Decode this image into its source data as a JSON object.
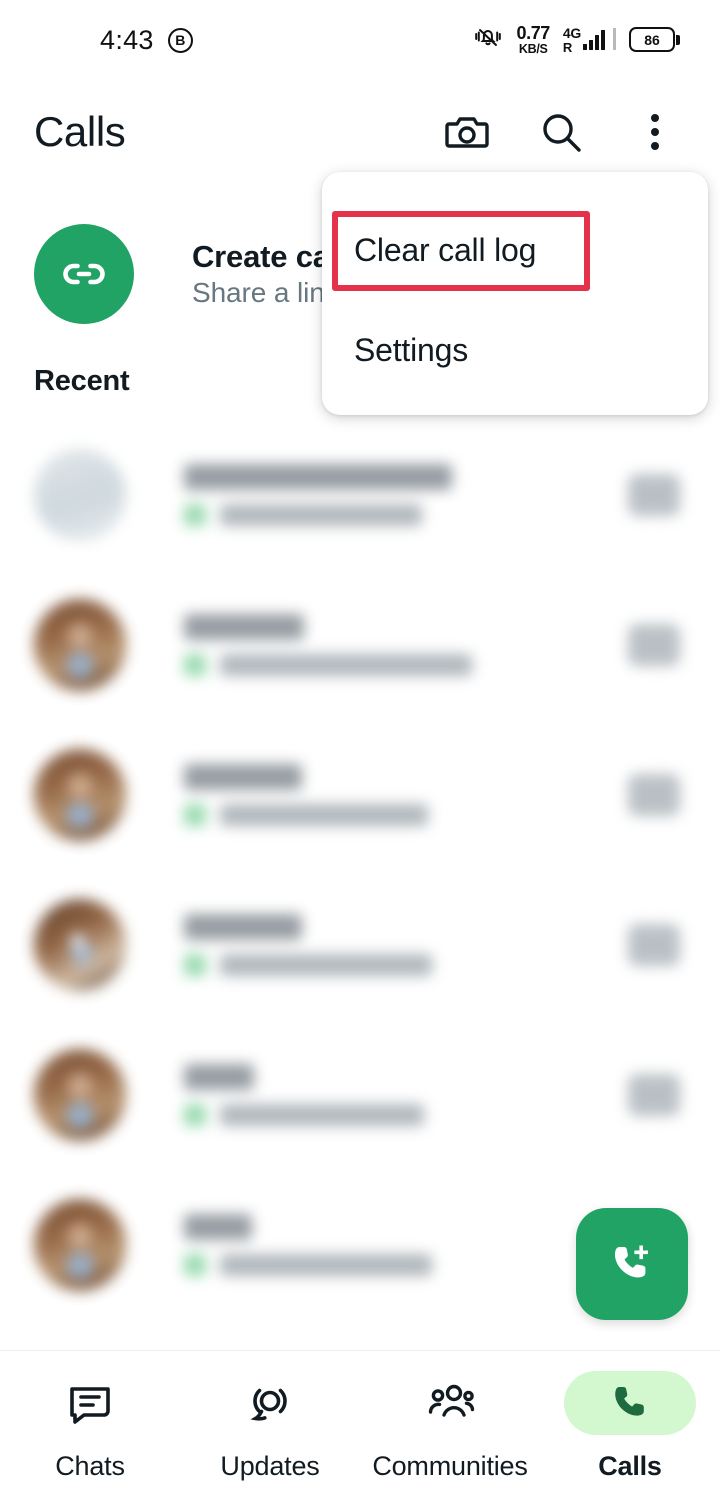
{
  "status_bar": {
    "time": "4:43",
    "badge_icon": "b-bubble-icon",
    "badge_label": "B",
    "mute_icon": "bell-muted-icon",
    "net_speed_value": "0.77",
    "net_speed_unit": "KB/S",
    "network_type": "4G",
    "roaming_label": "R",
    "battery_percent": "86"
  },
  "app_bar": {
    "title": "Calls",
    "actions": [
      {
        "name": "camera-icon",
        "label": "Camera"
      },
      {
        "name": "search-icon",
        "label": "Search"
      },
      {
        "name": "overflow-menu-icon",
        "label": "More options"
      }
    ]
  },
  "create_call_link": {
    "icon": "link-icon",
    "title": "Create call link",
    "subtitle": "Share a link",
    "avatar_color": "#21a366"
  },
  "sections": {
    "recent_label": "Recent"
  },
  "call_list": {
    "rows": [
      {
        "name": "redacted-contact-1",
        "avatar": "blank",
        "meta": "redacted",
        "action": "video-call-icon"
      },
      {
        "name": "redacted-contact-2",
        "avatar": "photo",
        "meta": "redacted",
        "action": "video-call-icon"
      },
      {
        "name": "redacted-contact-3",
        "avatar": "photo",
        "meta": "redacted",
        "action": "video-call-icon"
      },
      {
        "name": "redacted-contact-4",
        "avatar": "photo2",
        "meta": "redacted",
        "action": "video-call-icon"
      },
      {
        "name": "redacted-contact-5",
        "avatar": "photo",
        "meta": "redacted",
        "action": "video-call-icon"
      },
      {
        "name": "redacted-contact-6",
        "avatar": "photo",
        "meta": "redacted",
        "action": "video-call-icon"
      }
    ]
  },
  "fab": {
    "icon": "phone-add-icon",
    "label": "New call",
    "color": "#21a366"
  },
  "overflow_menu": {
    "items": [
      {
        "label": "Clear call log",
        "name": "menu-item-clear-call-log",
        "highlighted": true
      },
      {
        "label": "Settings",
        "name": "menu-item-settings",
        "highlighted": false
      }
    ],
    "highlight_color": "#e5324b"
  },
  "bottom_nav": {
    "items": [
      {
        "label": "Chats",
        "icon": "chats-icon",
        "active": false
      },
      {
        "label": "Updates",
        "icon": "updates-icon",
        "active": false
      },
      {
        "label": "Communities",
        "icon": "communities-icon",
        "active": false
      },
      {
        "label": "Calls",
        "icon": "phone-icon",
        "active": true
      }
    ],
    "active_pill_color": "#d3f7cf",
    "active_icon_color": "#1d6b3f"
  }
}
